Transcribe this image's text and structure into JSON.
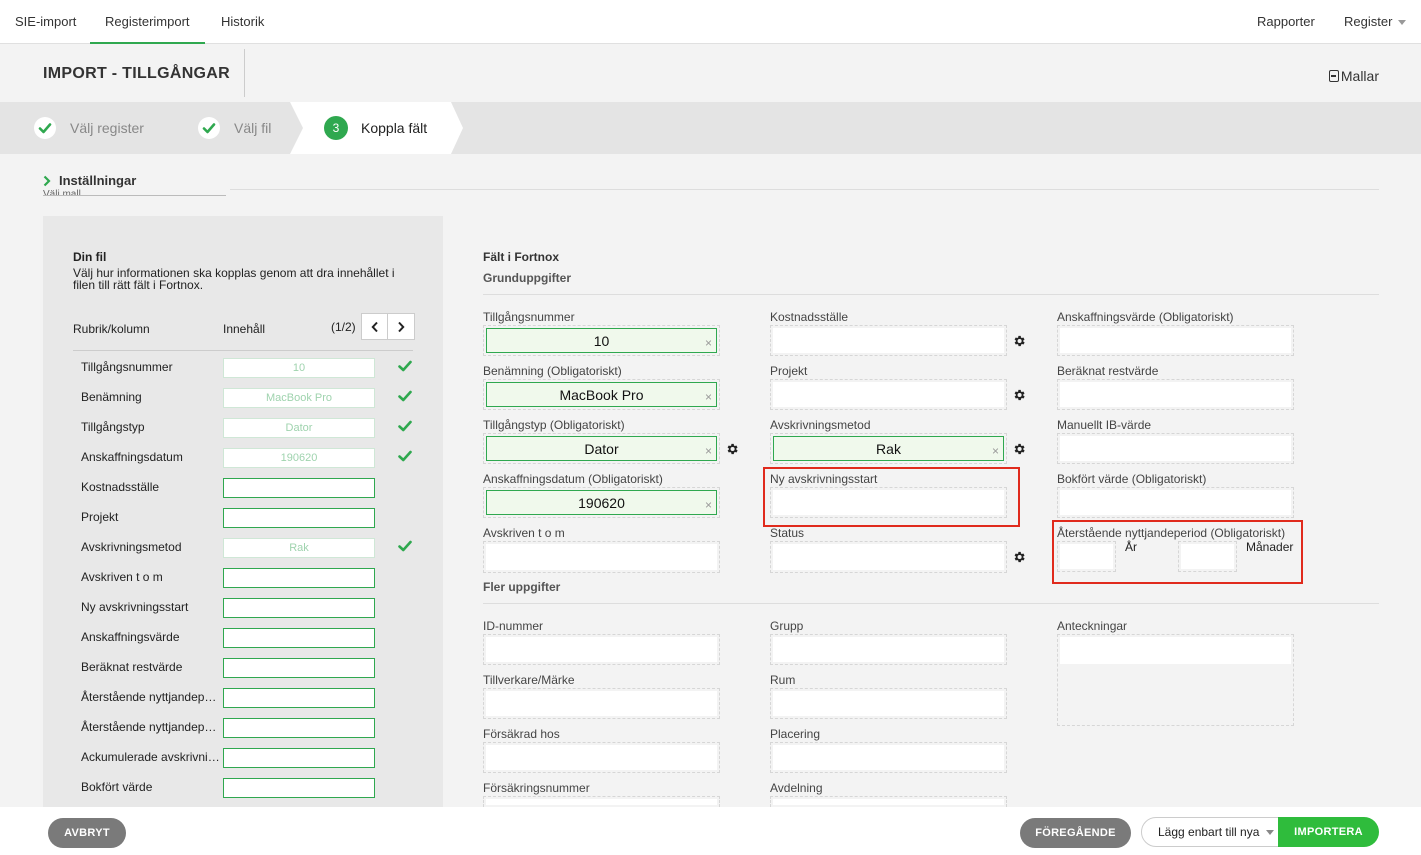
{
  "topnav": {
    "tabs": [
      "SIE-import",
      "Registerimport",
      "Historik"
    ],
    "right": [
      "Rapporter",
      "Register"
    ]
  },
  "header": {
    "title": "IMPORT - TILLGÅNGAR",
    "mallar": "Mallar"
  },
  "stepper": {
    "steps": [
      "Välj register",
      "Välj fil",
      "Koppla fält"
    ],
    "current_number": "3"
  },
  "settings": {
    "label": "Inställningar",
    "template_select": "Välj mall..."
  },
  "left": {
    "title": "Din fil",
    "description": "Välj hur informationen ska kopplas genom att dra innehållet i filen till rätt fält i Fortnox.",
    "col_header": "Rubrik/kolumn",
    "content_header": "Innehåll",
    "pager": "(1/2)",
    "rows": [
      {
        "label": "Tillgångsnummer",
        "value": "10"
      },
      {
        "label": "Benämning",
        "value": "MacBook Pro"
      },
      {
        "label": "Tillgångstyp",
        "value": "Dator"
      },
      {
        "label": "Anskaffningsdatum",
        "value": "190620"
      },
      {
        "label": "Kostnadsställe",
        "value": ""
      },
      {
        "label": "Projekt",
        "value": ""
      },
      {
        "label": "Avskrivningsmetod",
        "value": "Rak"
      },
      {
        "label": "Avskriven t o m",
        "value": ""
      },
      {
        "label": "Ny avskrivningsstart",
        "value": ""
      },
      {
        "label": "Anskaffningsvärde",
        "value": ""
      },
      {
        "label": "Beräknat restvärde",
        "value": ""
      },
      {
        "label": "Återstående nyttjandeperiod",
        "value": ""
      },
      {
        "label": "Återstående nyttjandeperiod",
        "value": ""
      },
      {
        "label": "Ackumulerade avskrivningar",
        "value": ""
      },
      {
        "label": "Bokfört värde",
        "value": ""
      }
    ]
  },
  "right": {
    "title": "Fält i Fortnox",
    "grund": "Grunduppgifter",
    "fler": "Fler uppgifter",
    "fields": {
      "tillgangsnummer": {
        "label": "Tillgångsnummer",
        "value": "10"
      },
      "benamning": {
        "label": "Benämning (Obligatoriskt)",
        "value": "MacBook Pro"
      },
      "tillgangstyp": {
        "label": "Tillgångstyp (Obligatoriskt)",
        "value": "Dator"
      },
      "anskaffningsdatum": {
        "label": "Anskaffningsdatum (Obligatoriskt)",
        "value": "190620"
      },
      "avskriven": {
        "label": "Avskriven t o m"
      },
      "kostnadsstalle": {
        "label": "Kostnadsställe"
      },
      "projekt": {
        "label": "Projekt"
      },
      "avskrivningsmetod": {
        "label": "Avskrivningsmetod",
        "value": "Rak"
      },
      "ny_avskrivningsstart": {
        "label": "Ny avskrivningsstart"
      },
      "status": {
        "label": "Status"
      },
      "anskaffningsvarde": {
        "label": "Anskaffningsvärde (Obligatoriskt)"
      },
      "beraknat_restvarde": {
        "label": "Beräknat restvärde"
      },
      "manuellt_ib": {
        "label": "Manuellt IB-värde"
      },
      "bokfort_varde": {
        "label": "Bokfört värde (Obligatoriskt)"
      },
      "aterstaende": {
        "label": "Återstående nyttjandeperiod (Obligatoriskt)",
        "ar": "År",
        "manader": "Månader"
      },
      "id_nummer": {
        "label": "ID-nummer"
      },
      "tillverkare": {
        "label": "Tillverkare/Märke"
      },
      "forsakrad_hos": {
        "label": "Försäkrad hos"
      },
      "forsakringsnummer": {
        "label": "Försäkringsnummer"
      },
      "grupp": {
        "label": "Grupp"
      },
      "rum": {
        "label": "Rum"
      },
      "placering": {
        "label": "Placering"
      },
      "avdelning": {
        "label": "Avdelning"
      },
      "anteckningar": {
        "label": "Anteckningar"
      }
    }
  },
  "footer": {
    "cancel": "AVBRYT",
    "previous": "FÖREGÅENDE",
    "mode_select": "Lägg enbart till nya",
    "import": "IMPORTERA"
  },
  "colors": {
    "accent_green": "#2fa84f",
    "highlight_red": "#e02a1c"
  }
}
